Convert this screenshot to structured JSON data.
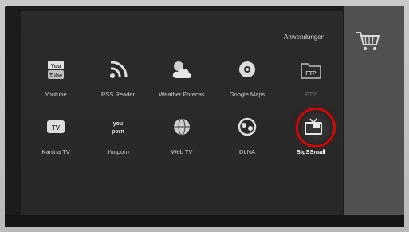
{
  "section": {
    "title": "Anwendungen",
    "icon": "shopping-cart-icon"
  },
  "apps": [
    {
      "label": "Youtube",
      "icon": "youtube-icon"
    },
    {
      "label": "RSS Reader",
      "icon": "rss-icon"
    },
    {
      "label": "Weather Forecas",
      "icon": "weather-icon"
    },
    {
      "label": "Google Maps",
      "icon": "globe-icon"
    },
    {
      "label": "FTP",
      "icon": "ftp-folder-icon"
    },
    {
      "label": "Kartina TV",
      "icon": "tv-icon"
    },
    {
      "label": "Youporn",
      "icon": "youporn-icon"
    },
    {
      "label": "Web TV",
      "icon": "web-tv-icon"
    },
    {
      "label": "DLNA",
      "icon": "dlna-icon"
    },
    {
      "label": "BigSSmall",
      "icon": "tv-screen-icon",
      "selected": true
    }
  ],
  "colors": {
    "selection_ring": "#b01414",
    "panel_background": "#2b2b2b"
  }
}
